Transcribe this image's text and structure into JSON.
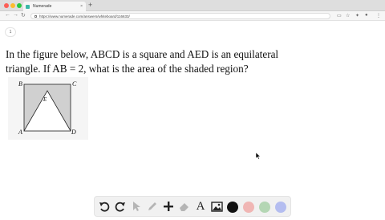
{
  "browser": {
    "tab_title": "Numerade",
    "tab_close": "×",
    "new_tab": "+",
    "url": "https://www.numerade.com/answers/whiteboard/116633/"
  },
  "page": {
    "page_number": "1",
    "question": "In the figure below, ABCD is a square and AED is an equilateral triangle. If AB = 2, what is the area of the shaded region?"
  },
  "figure": {
    "labels": {
      "B": "B",
      "C": "C",
      "E": "E",
      "A": "A",
      "D": "D"
    },
    "shaded_color": "#d0d0d0"
  },
  "toolbar": {
    "tools": [
      "undo-icon",
      "redo-icon",
      "pointer-icon",
      "pen-icon",
      "add-icon",
      "eraser-icon",
      "text-icon",
      "image-icon"
    ],
    "text_tool_label": "A",
    "colors": [
      "#111111",
      "#f0b6b4",
      "#b4d6b4",
      "#b4bdf0"
    ]
  }
}
